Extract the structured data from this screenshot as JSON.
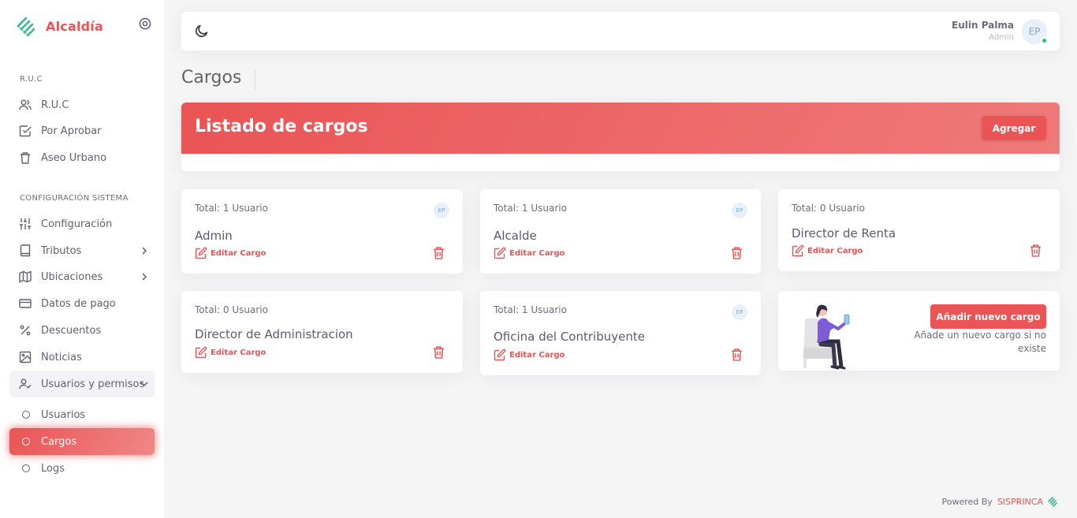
{
  "brand": {
    "name": "Alcaldía",
    "color": "#ea5455",
    "logo_icon": "alcaldia-logo-icon"
  },
  "sidebar": {
    "section1": "R.U.C",
    "section2": "CONFIGURACIÓN SISTEMA",
    "items": [
      {
        "label": "R.U.C",
        "icon": "users-icon"
      },
      {
        "label": "Por Aprobar",
        "icon": "check-square-icon"
      },
      {
        "label": "Aseo Urbano",
        "icon": "trash-icon"
      },
      {
        "label": "Configuración",
        "icon": "sliders-icon"
      },
      {
        "label": "Tributos",
        "icon": "book-icon"
      },
      {
        "label": "Ubicaciones",
        "icon": "map-icon"
      },
      {
        "label": "Datos de pago",
        "icon": "credit-card-icon"
      },
      {
        "label": "Descuentos",
        "icon": "percent-icon"
      },
      {
        "label": "Noticias",
        "icon": "image-icon"
      },
      {
        "label": "Usuarios y permisos",
        "icon": "user-check-icon"
      }
    ],
    "subitems": [
      {
        "label": "Usuarios"
      },
      {
        "label": "Cargos",
        "active": true
      },
      {
        "label": "Logs"
      }
    ]
  },
  "navbar": {
    "user_name": "Eulin Palma",
    "user_role": "Admin",
    "avatar_initials": "EP",
    "status_color": "#28c76f"
  },
  "page": {
    "title": "Cargos",
    "banner_title": "Listado de cargos",
    "add_button": "Agregar"
  },
  "roles": [
    {
      "total": "Total: 1 Usuario",
      "name": "Admin",
      "avatar": "EP",
      "edit": "Editar Cargo"
    },
    {
      "total": "Total: 1 Usuario",
      "name": "Alcalde",
      "avatar": "EP",
      "edit": "Editar Cargo"
    },
    {
      "total": "Total: 0 Usuario",
      "name": "Director de Renta",
      "edit": "Editar Cargo"
    },
    {
      "total": "Total: 0 Usuario",
      "name": "Director de Administracion",
      "edit": "Editar Cargo"
    },
    {
      "total": "Total: 1 Usuario",
      "name": "Oficina del Contribuyente",
      "avatar": "EP",
      "edit": "Editar Cargo"
    }
  ],
  "add_card": {
    "button": "Añadir nuevo cargo",
    "description": "Añade un nuevo cargo si no existe"
  },
  "footer": {
    "powered": "Powered By",
    "brand": "SISPRINCA"
  }
}
